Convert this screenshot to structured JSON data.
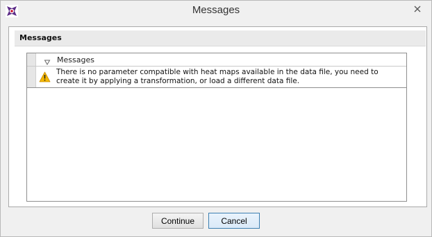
{
  "window": {
    "title": "Messages",
    "app_icon": "flowjo-logo-icon",
    "close_icon": "close-icon"
  },
  "panel": {
    "header": "Messages"
  },
  "list": {
    "column_header": "Messages",
    "sort_icon": "sort-triangle-icon",
    "rows": [
      {
        "icon": "warning-icon",
        "text": "There is no parameter compatible with heat maps available in the data file, you need to create it by applying a transformation, or load a different data file."
      }
    ]
  },
  "buttons": {
    "continue": "Continue",
    "cancel": "Cancel"
  },
  "colors": {
    "warning": "#f5b800",
    "accent_border": "#3c7fb1",
    "logo": "#5b2a86"
  }
}
